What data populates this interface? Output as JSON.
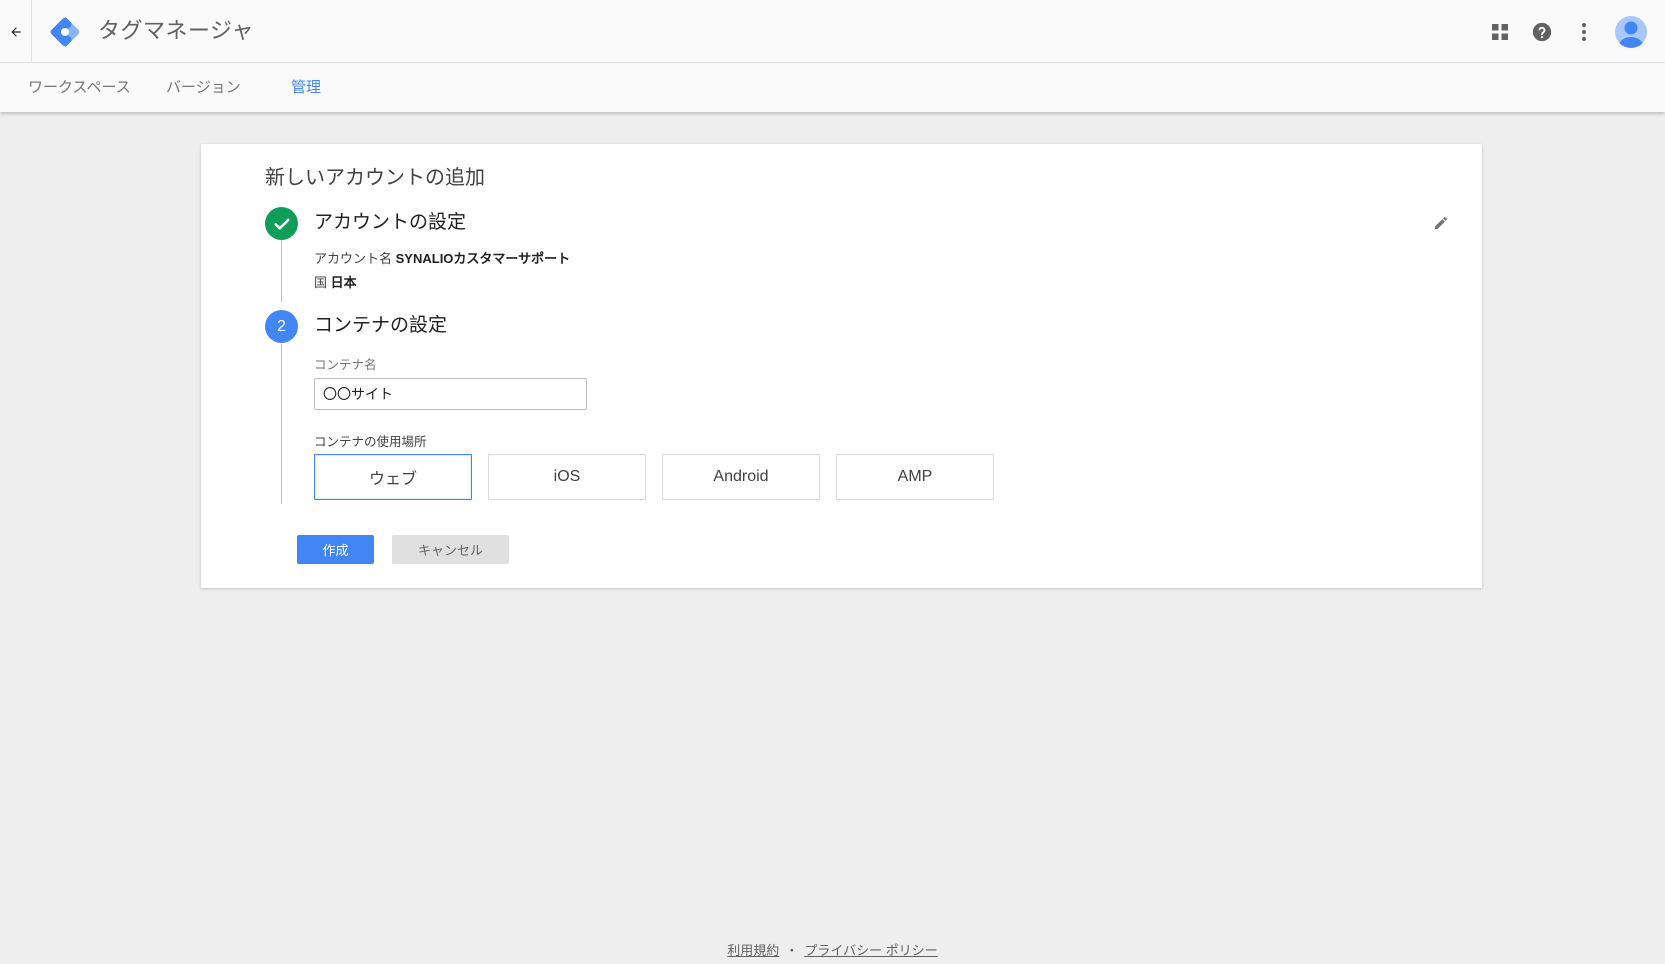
{
  "app": {
    "title": "タグマネージャ"
  },
  "header_icons": [
    "back-arrow-icon",
    "apps-grid-icon",
    "help-icon",
    "more-vert-icon",
    "account-avatar-icon"
  ],
  "tabs": [
    {
      "label": "ワークスペース",
      "active": false
    },
    {
      "label": "バージョン",
      "active": false
    },
    {
      "label": "管理",
      "active": true
    }
  ],
  "card": {
    "title": "新しいアカウントの追加",
    "step1": {
      "title": "アカウントの設定",
      "status": "done",
      "account_name_label": "アカウント名",
      "account_name_value": "SYNALIOカスタマーサポート",
      "country_label": "国",
      "country_value": "日本"
    },
    "step2": {
      "number": "2",
      "title": "コンテナの設定",
      "container_name_label": "コンテナ名",
      "container_name_value": "〇〇サイト",
      "usage_label": "コンテナの使用場所",
      "platforms": [
        {
          "label": "ウェブ",
          "selected": true
        },
        {
          "label": "iOS",
          "selected": false
        },
        {
          "label": "Android",
          "selected": false
        },
        {
          "label": "AMP",
          "selected": false
        }
      ]
    },
    "create_label": "作成",
    "cancel_label": "キャンセル"
  },
  "footer": {
    "terms_label": "利用規約",
    "separator": "・",
    "privacy_label": "プライバシー ポリシー"
  },
  "colors": {
    "accent": "#4285f4",
    "success": "#0f9d58",
    "background": "#eeeeee"
  }
}
